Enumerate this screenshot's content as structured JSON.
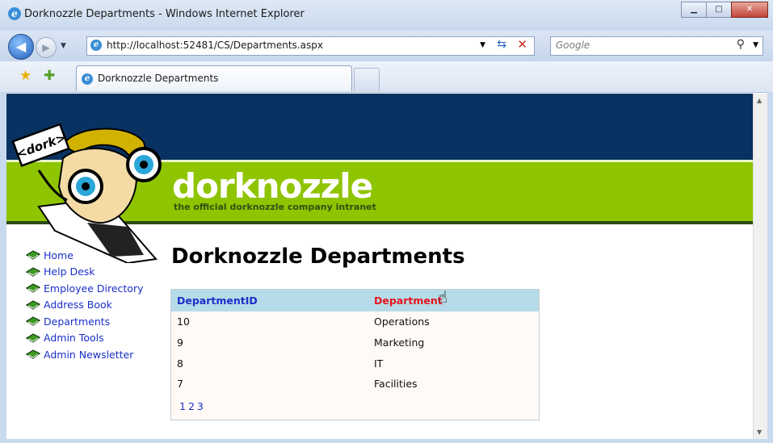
{
  "window": {
    "title": "Dorknozzle Departments - Windows Internet Explorer"
  },
  "address_bar": {
    "url": "http://localhost:52481/CS/Departments.aspx"
  },
  "search_box": {
    "placeholder": "Google"
  },
  "tab": {
    "label": "Dorknozzle Departments"
  },
  "site": {
    "brand": "dorknozzle",
    "tagline": "the official dorknozzle company intranet",
    "logo_text": "<dork>"
  },
  "sidenav": {
    "items": [
      {
        "label": "Home"
      },
      {
        "label": "Help Desk"
      },
      {
        "label": "Employee Directory"
      },
      {
        "label": "Address Book"
      },
      {
        "label": "Departments"
      },
      {
        "label": "Admin Tools"
      },
      {
        "label": "Admin Newsletter"
      }
    ]
  },
  "main": {
    "title": "Dorknozzle Departments",
    "grid": {
      "columns": [
        "DepartmentID",
        "Department"
      ],
      "rows": [
        [
          "10",
          "Operations"
        ],
        [
          "9",
          "Marketing"
        ],
        [
          "8",
          "IT"
        ],
        [
          "7",
          "Facilities"
        ]
      ],
      "pages": [
        "1",
        "2",
        "3"
      ]
    }
  },
  "colors": {
    "header_dark": "#083261",
    "header_green": "#8fc400",
    "link": "#1a2fc8",
    "sorted_header": "#e8141f"
  }
}
